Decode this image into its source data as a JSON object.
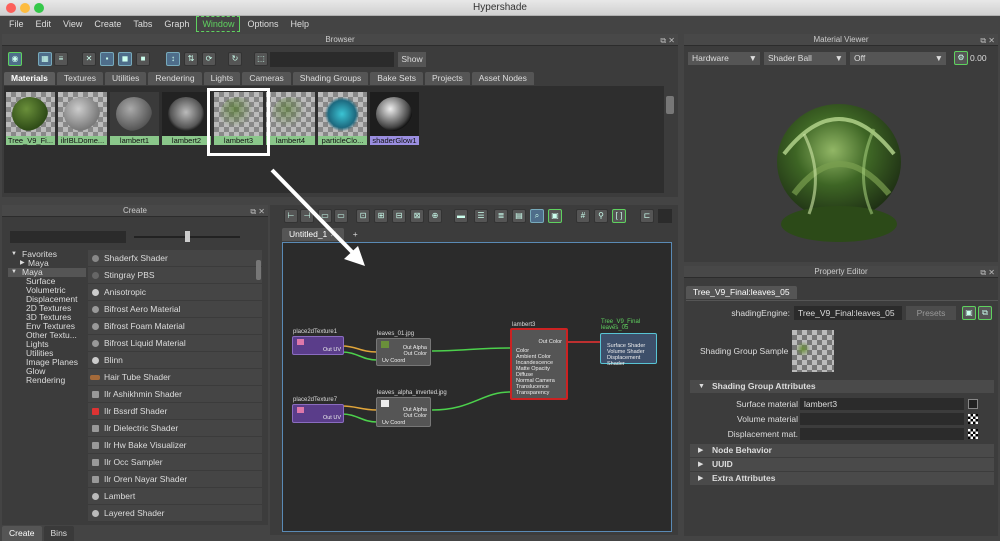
{
  "window": {
    "title": "Hypershade"
  },
  "menu": [
    "File",
    "Edit",
    "View",
    "Create",
    "Tabs",
    "Graph",
    "Window",
    "Options",
    "Help"
  ],
  "browser": {
    "title": "Browser",
    "show_label": "Show",
    "tabs": [
      "Materials",
      "Textures",
      "Utilities",
      "Rendering",
      "Lights",
      "Cameras",
      "Shading Groups",
      "Bake Sets",
      "Projects",
      "Asset Nodes"
    ],
    "swatches": [
      "Tree_V9_Fi...",
      "ilrIBLDome...",
      "lambert1",
      "lambert2",
      "lambert3",
      "lambert4",
      "particleClo...",
      "shaderGlow1"
    ]
  },
  "create": {
    "title": "Create",
    "categories": [
      "Favorites",
      "Maya",
      "Maya",
      "Surface",
      "Volumetric",
      "Displacement",
      "2D Textures",
      "3D Textures",
      "Env Textures",
      "Other Textu...",
      "Lights",
      "Utilities",
      "Image Planes",
      "Glow",
      "Rendering"
    ],
    "items": [
      "Shaderfx Shader",
      "Stingray PBS",
      "Anisotropic",
      "Bifrost Aero Material",
      "Bifrost Foam Material",
      "Bifrost Liquid Material",
      "Blinn",
      "Hair Tube Shader",
      "Ilr Ashikhmin Shader",
      "Ilr Bssrdf Shader",
      "Ilr Dielectric Shader",
      "Ilr Hw Bake Visualizer",
      "Ilr Occ Sampler",
      "Ilr Oren Nayar Shader",
      "Lambert",
      "Layered Shader"
    ],
    "bottom_tabs": [
      "Create",
      "Bins"
    ]
  },
  "graph": {
    "tab": "Untitled_1",
    "nodes": {
      "p2d1": {
        "title": "place2dTexture1",
        "port": "Out UV"
      },
      "p2d7": {
        "title": "place2dTexture7",
        "port": "Out UV"
      },
      "file1": {
        "title": "leaves_01.jpg",
        "ports": [
          "Out Alpha",
          "Out Color",
          "Uv Coord"
        ]
      },
      "file2": {
        "title": "leaves_alpha_inverted.jpg",
        "ports": [
          "Out Alpha",
          "Out Color",
          "Uv Coord"
        ]
      },
      "lambert": {
        "title": "lambert3",
        "ports": [
          "Out Color",
          "Color",
          "Ambient Color",
          "Incandescence",
          "Matte Opacity",
          "Diffuse",
          "Normal Camera",
          "Translucence",
          "Transparency"
        ]
      },
      "sg": {
        "title": "Tree_V9_Final\nleaves_05",
        "ports": [
          "Surface Shader",
          "Volume Shader",
          "Displacement Shader"
        ]
      }
    }
  },
  "viewer": {
    "title": "Material Viewer",
    "renderer": "Hardware",
    "shape": "Shader Ball",
    "env": "Off",
    "value": "0.00"
  },
  "property_editor": {
    "title": "Property Editor",
    "tab": "Tree_V9_Final:leaves_05",
    "type_label": "shadingEngine:",
    "name_value": "Tree_V9_Final:leaves_05",
    "presets": "Presets",
    "sample_label": "Shading Group Sample",
    "section_open": "Shading Group Attributes",
    "attrs": [
      {
        "label": "Surface material",
        "value": "lambert3"
      },
      {
        "label": "Volume material",
        "value": ""
      },
      {
        "label": "Displacement mat.",
        "value": ""
      }
    ],
    "sections_closed": [
      "Node Behavior",
      "UUID",
      "Extra Attributes"
    ]
  },
  "colors": {
    "accent_green": "#5fd25f",
    "selected_lambert": "#ffffff",
    "shader_group_green": "#8ac78a",
    "shader_glow_purple": "#9a8ee0"
  }
}
